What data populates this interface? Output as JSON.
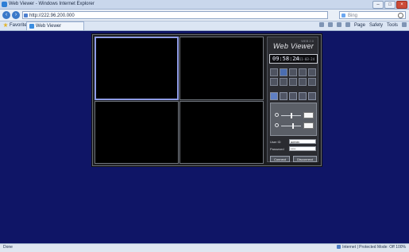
{
  "browser": {
    "window_title": "Web Viewer - Windows Internet Explorer",
    "url": "http://222.96.200.000",
    "search_placeholder": "Bing",
    "tab_title": "Web Viewer",
    "favorites_label": "Favorites",
    "favorite_item": "Web Viewer",
    "toolbar": {
      "page": "Page",
      "safety": "Safety",
      "tools": "Tools"
    },
    "status_left": "Done",
    "status_zone": "Internet | Protected Mode: Off",
    "status_zoom": "100%"
  },
  "viewer": {
    "title": "Web Viewer",
    "subtitle": "WEB 2.0",
    "time": "09:58:24",
    "date": "2011-03-24",
    "login": {
      "user_label": "User ID",
      "password_label": "Password",
      "user_value": "admin",
      "password_value": "****",
      "connect_label": "Connect",
      "disconnect_label": "Disconnect"
    }
  },
  "colors": {
    "page_bg": "#0f1566",
    "active_border": "#8e9be6",
    "panel_bg": "#2b2c31"
  }
}
